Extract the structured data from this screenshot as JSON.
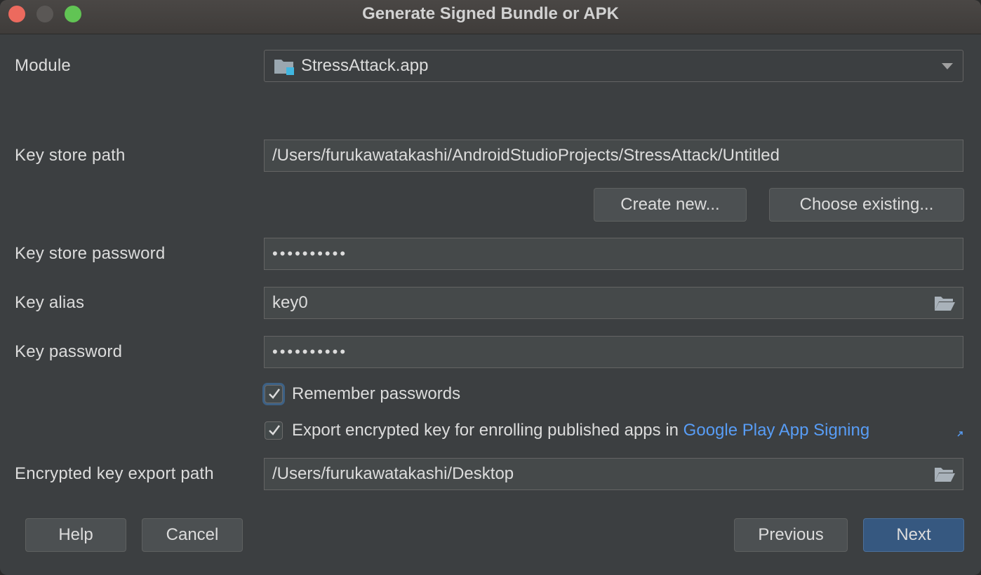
{
  "window": {
    "title": "Generate Signed Bundle or APK",
    "buttons": [
      "close",
      "minimize",
      "maximize"
    ]
  },
  "form": {
    "module": {
      "label": "Module",
      "value": "StressAttack.app",
      "icon": "module-folder-icon"
    },
    "key_store_path": {
      "label": "Key store path",
      "value": "/Users/furukawatakashi/AndroidStudioProjects/StressAttack/Untitled"
    },
    "create_new_label": "Create new...",
    "choose_existing_label": "Choose existing...",
    "key_store_password": {
      "label": "Key store password",
      "value": "••••••••••"
    },
    "key_alias": {
      "label": "Key alias",
      "value": "key0",
      "icon": "folder-open-icon"
    },
    "key_password": {
      "label": "Key password",
      "value": "••••••••••"
    },
    "remember_passwords": {
      "label": "Remember passwords",
      "checked": true
    },
    "export_encrypted_key": {
      "label": "Export encrypted key for enrolling published apps in",
      "link": "Google Play App Signing",
      "checked": true
    },
    "encrypted_key_export_path": {
      "label": "Encrypted key export path",
      "value": "/Users/furukawatakashi/Desktop",
      "icon": "folder-open-icon"
    }
  },
  "footer": {
    "help_label": "Help",
    "cancel_label": "Cancel",
    "previous_label": "Previous",
    "next_label": "Next"
  },
  "colors": {
    "background": "#3c3f41",
    "field": "#45494a",
    "primary_button": "#365880",
    "link": "#589df6"
  }
}
